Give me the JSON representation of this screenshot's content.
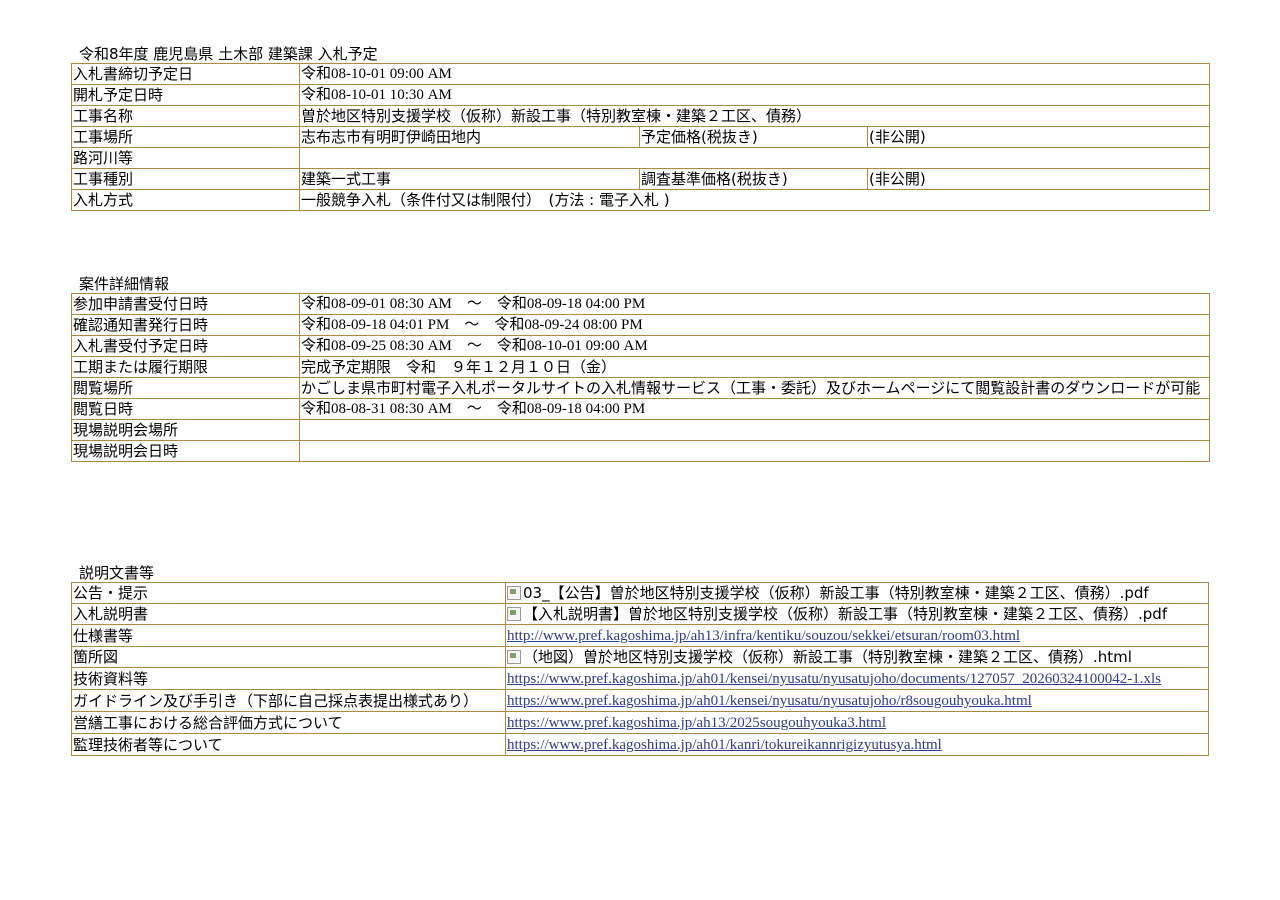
{
  "section1": {
    "title": "令和8年度 鹿児島県 土木部 建築課 入札予定",
    "rows": {
      "deadline": {
        "label": "入札書締切予定日",
        "value": "令和08-10-01 09:00 AM"
      },
      "opening": {
        "label": "開札予定日時",
        "value": "令和08-10-01 10:30 AM"
      },
      "name": {
        "label": "工事名称",
        "value": "曽於地区特別支援学校（仮称）新設工事（特別教室棟・建築２工区、債務）"
      },
      "place": {
        "label": "工事場所",
        "value": "志布志市有明町伊崎田地内",
        "sub_label": "予定価格(税抜き)",
        "sub_value": "(非公開)"
      },
      "road": {
        "label": "路河川等",
        "value": ""
      },
      "kind": {
        "label": "工事種別",
        "value": "建築一式工事",
        "sub_label": "調査基準価格(税抜き)",
        "sub_value": "(非公開)"
      },
      "method": {
        "label": "入札方式",
        "value": "一般競争入札（条件付又は制限付）　(方法 : 電子入札 )"
      }
    }
  },
  "section2": {
    "title": "案件詳細情報",
    "rows": {
      "apply": {
        "label": "参加申請書受付日時",
        "value": "令和08-09-01 08:30 AM　～　令和08-09-18 04:00 PM"
      },
      "notice": {
        "label": "確認通知書発行日時",
        "value": "令和08-09-18 04:01 PM　～　令和08-09-24 08:00 PM"
      },
      "receipt": {
        "label": "入札書受付予定日時",
        "value": "令和08-09-25 08:30 AM　～　令和08-10-01 09:00 AM"
      },
      "period": {
        "label": "工期または履行期限",
        "value": "完成予定期限　令和　９年１２月１０日（金）"
      },
      "view_place": {
        "label": "閲覧場所",
        "value": "かごしま県市町村電子入札ポータルサイトの入札情報サービス（工事・委託）及びホームページにて閲覧設計書のダウンロードが可能"
      },
      "view_date": {
        "label": "閲覧日時",
        "value": "令和08-08-31 08:30 AM　～　令和08-09-18 04:00 PM"
      },
      "site_place": {
        "label": "現場説明会場所",
        "value": ""
      },
      "site_date": {
        "label": "現場説明会日時",
        "value": ""
      }
    }
  },
  "section3": {
    "title": "説明文書等",
    "rows": {
      "announce": {
        "label": "公告・提示",
        "value": "03_【公告】曽於地区特別支援学校（仮称）新設工事（特別教室棟・建築２工区、債務）.pdf"
      },
      "explain": {
        "label": "入札説明書",
        "value": "【入札説明書】曽於地区特別支援学校（仮称）新設工事（特別教室棟・建築２工区、債務）.pdf"
      },
      "spec": {
        "label": "仕様書等",
        "value": "http://www.pref.kagoshima.jp/ah13/infra/kentiku/souzou/sekkei/etsuran/room03.html"
      },
      "map": {
        "label": "箇所図",
        "value": "（地図）曽於地区特別支援学校（仮称）新設工事（特別教室棟・建築２工区、債務）.html"
      },
      "tech": {
        "label": "技術資料等",
        "value": "https://www.pref.kagoshima.jp/ah01/kensei/nyusatu/nyusatujoho/documents/127057_20260324100042-1.xls"
      },
      "guide": {
        "label": "ガイドライン及び手引き（下部に自己採点表提出様式あり）",
        "value": "https://www.pref.kagoshima.jp/ah01/kensei/nyusatu/nyusatujoho/r8sougouhyouka.html"
      },
      "eval": {
        "label": "営繕工事における総合評価方式について",
        "value": "https://www.pref.kagoshima.jp/ah13/2025sougouhyouka3.html"
      },
      "engineer": {
        "label": "監理技術者等について",
        "value": "https://www.pref.kagoshima.jp/ah01/kanri/tokureikannrigizyutusya.html"
      }
    }
  }
}
